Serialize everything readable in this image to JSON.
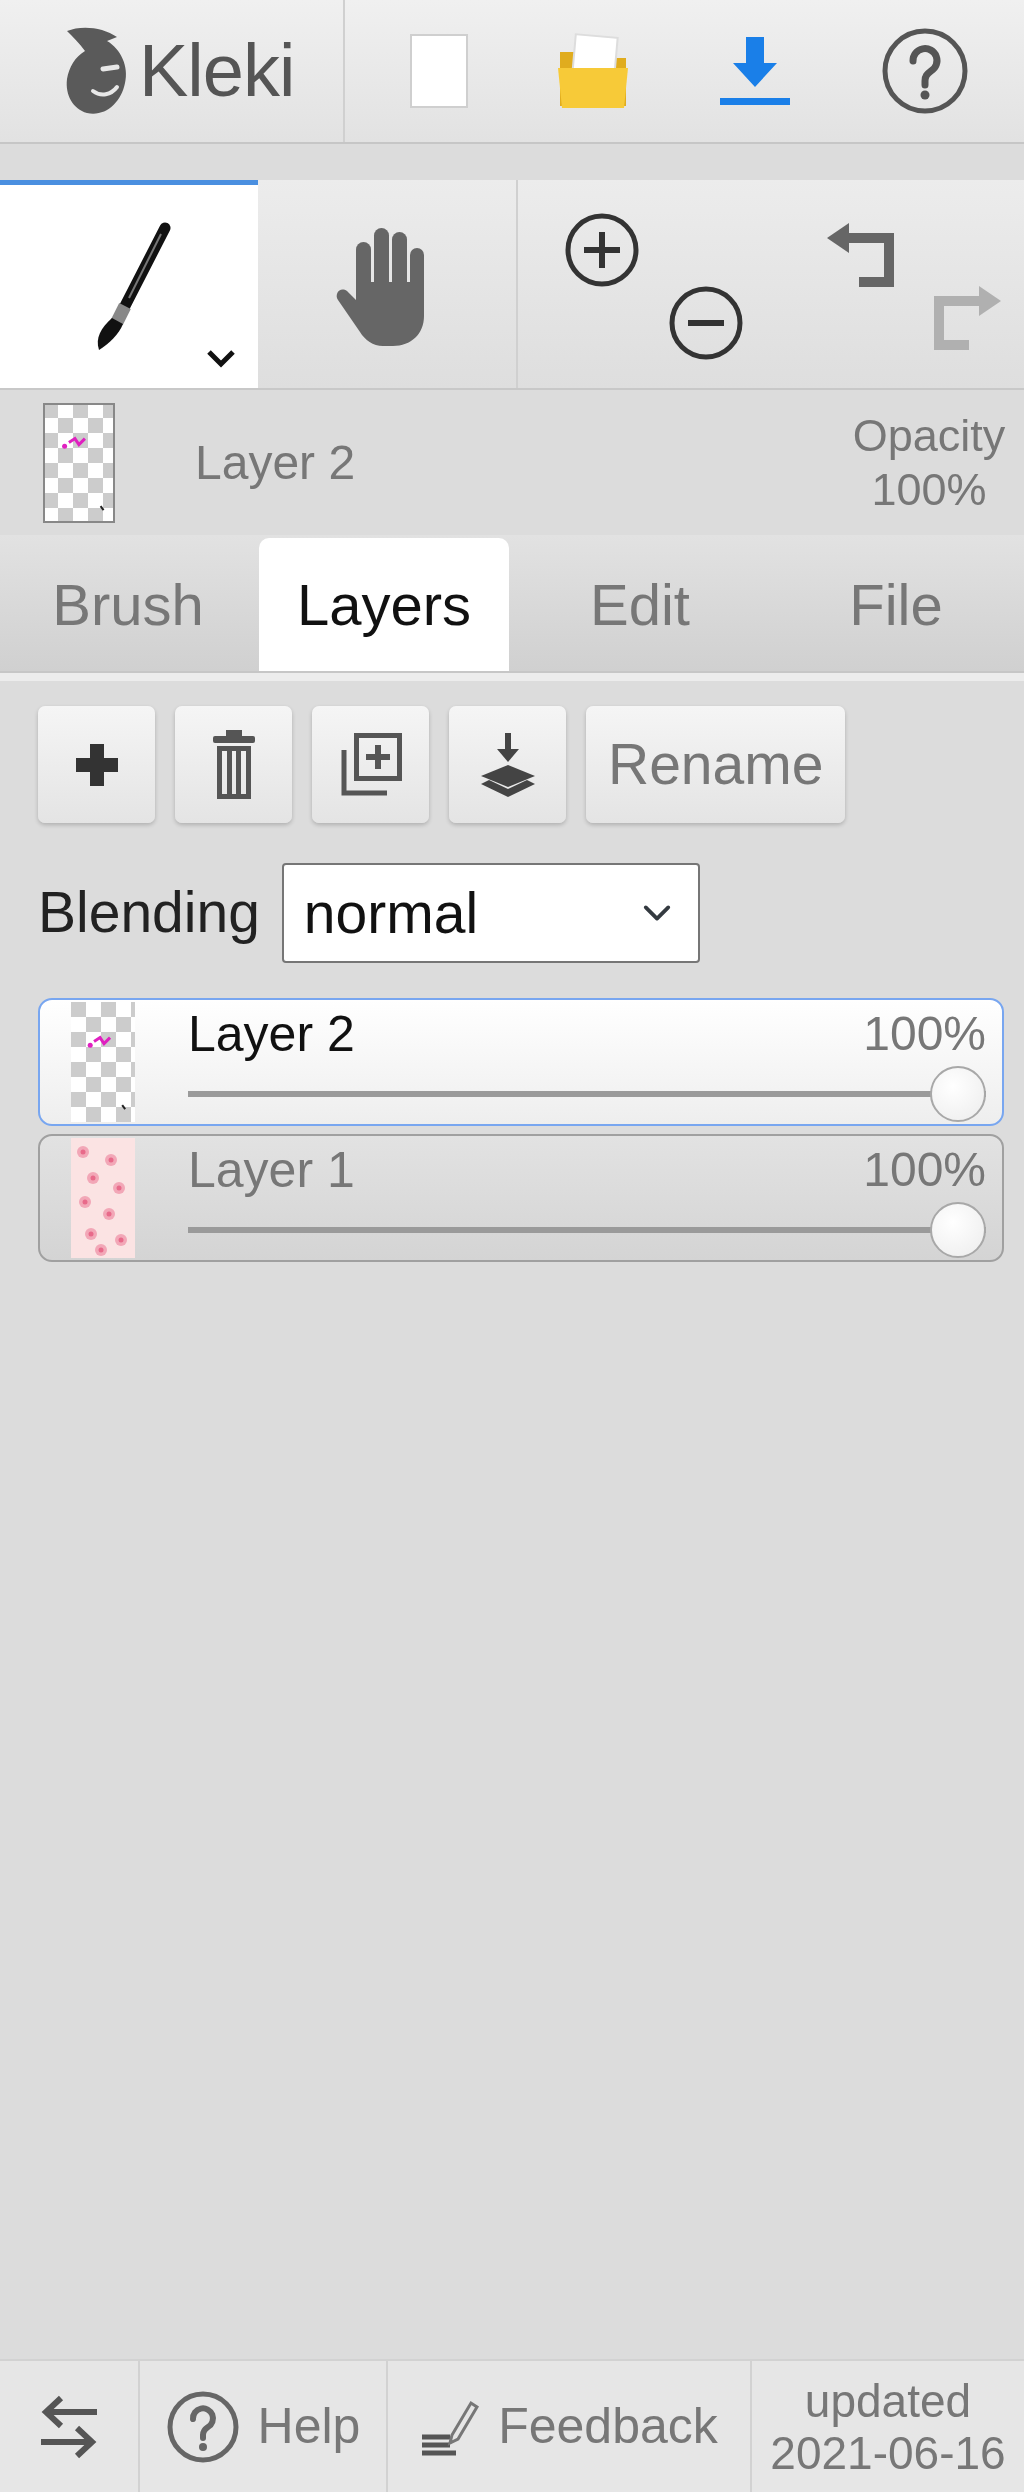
{
  "top_bar": {
    "logo": "Kleki"
  },
  "tools": [
    {
      "kind": "brush",
      "selected": true
    },
    {
      "kind": "hand",
      "selected": false
    }
  ],
  "history": [
    {
      "kind": "undo",
      "disabled": false
    },
    {
      "kind": "redo",
      "disabled": true
    }
  ],
  "current_layer": {
    "name": "Layer 2",
    "opacity_label": "Opacity",
    "opacity": "100%"
  },
  "tabs": [
    {
      "label": "Brush",
      "selected": false
    },
    {
      "label": "Layers",
      "selected": true
    },
    {
      "label": "Edit",
      "selected": false
    },
    {
      "label": "File",
      "selected": false
    }
  ],
  "layer_buttons": [
    {
      "kind": "add"
    },
    {
      "kind": "delete"
    },
    {
      "kind": "duplicate"
    },
    {
      "kind": "merge_down"
    },
    {
      "kind": "rename",
      "label": "Rename"
    }
  ],
  "blending": {
    "label": "Blending",
    "value": "normal"
  },
  "layers": [
    {
      "kind": "transparent",
      "name": "Layer 2",
      "opacity": "100%",
      "level": 1,
      "selected": true
    },
    {
      "kind": "floral",
      "name": "Layer 1",
      "opacity": "100%",
      "level": 1,
      "selected": false
    }
  ],
  "footer": {
    "buttons": [
      {
        "kind": "swap"
      },
      {
        "kind": "help",
        "label": "Help"
      },
      {
        "kind": "feedback",
        "label": "Feedback"
      }
    ],
    "updated_label": "updated",
    "updated_date": "2021-06-16"
  }
}
